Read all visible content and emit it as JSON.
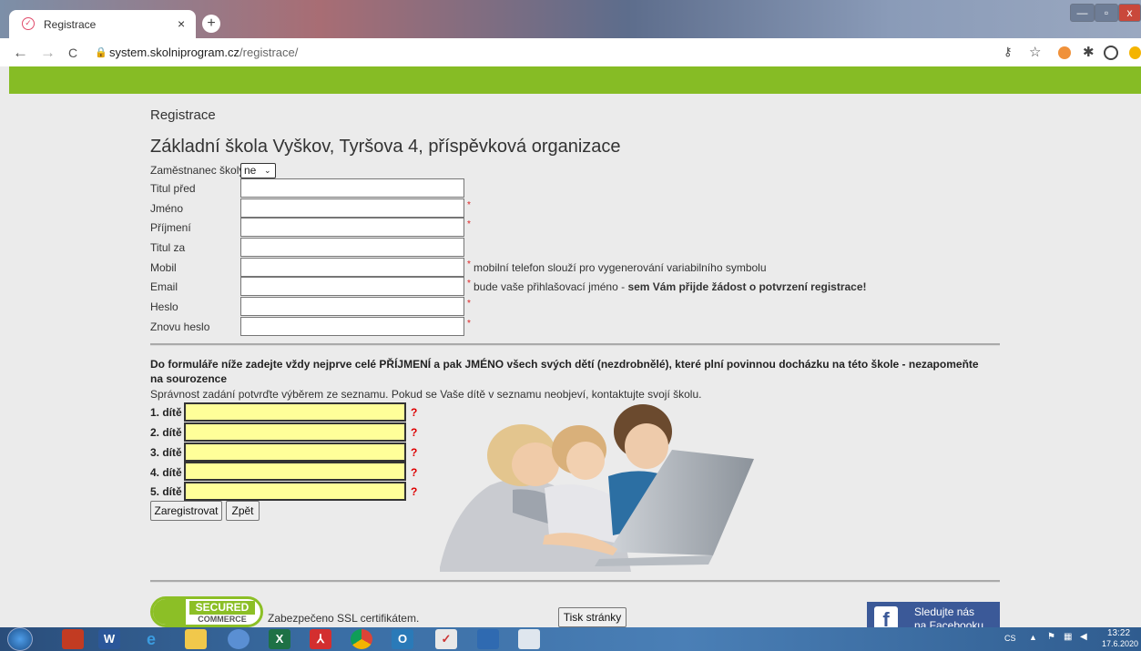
{
  "browser": {
    "tab_title": "Registrace",
    "tab_close": "×",
    "new_tab": "+",
    "url_domain": "system.skolniprogram.cz",
    "url_path": "/registrace/",
    "back": "←",
    "forward": "→",
    "reload": "C",
    "window_minimize": "—",
    "window_maximize": "▫",
    "window_close": "x"
  },
  "page": {
    "heading": "Registrace",
    "school_name": "Základní škola Vyškov, Tyršova 4, příspěvková organizace",
    "employee_label": "Zaměstnanec školy",
    "employee_value": "ne",
    "fields": {
      "title_before": "Titul před",
      "first_name": "Jméno",
      "surname": "Příjmení",
      "title_after": "Titul za",
      "mobile": "Mobil",
      "email": "Email",
      "password": "Heslo",
      "password_again": "Znovu heslo"
    },
    "required_mark": "*",
    "mobile_hint": "mobilní telefon slouží pro vygenerování variabilního symbolu",
    "email_hint_normal": "bude vaše přihlašovací jméno - ",
    "email_hint_bold": "sem Vám přijde žádost o potvrzení registrace!",
    "children_instructions": "Do formuláře níže zadejte vždy nejprve celé PŘÍJMENÍ a pak JMÉNO všech svých dětí (nezdrobnělé), které plní povinnou docházku na této škole - nezapomeňte na sourozence",
    "children_note": "Správnost zadání potvrďte výběrem ze seznamu. Pokud se Vaše dítě v seznamu neobjeví, kontaktujte svojí školu.",
    "children": [
      "1. dítě",
      "2. dítě",
      "3. dítě",
      "4. dítě",
      "5. dítě"
    ],
    "child_help": "?",
    "register_button": "Zaregistrovat",
    "back_button": "Zpět",
    "secured_line1": "SECURED",
    "secured_line2": "COMMERCE",
    "ssl_text": "Zabezpečeno SSL certifikátem.",
    "print_button": "Tisk stránky",
    "facebook_line1": "Sledujte nás",
    "facebook_line2": "na Facebooku"
  },
  "taskbar": {
    "language": "CS",
    "time": "13:22",
    "date": "17.6.2020"
  },
  "colors": {
    "green_bar": "#86bc25",
    "child_input_bg": "#ffff99",
    "facebook": "#3b5998"
  }
}
